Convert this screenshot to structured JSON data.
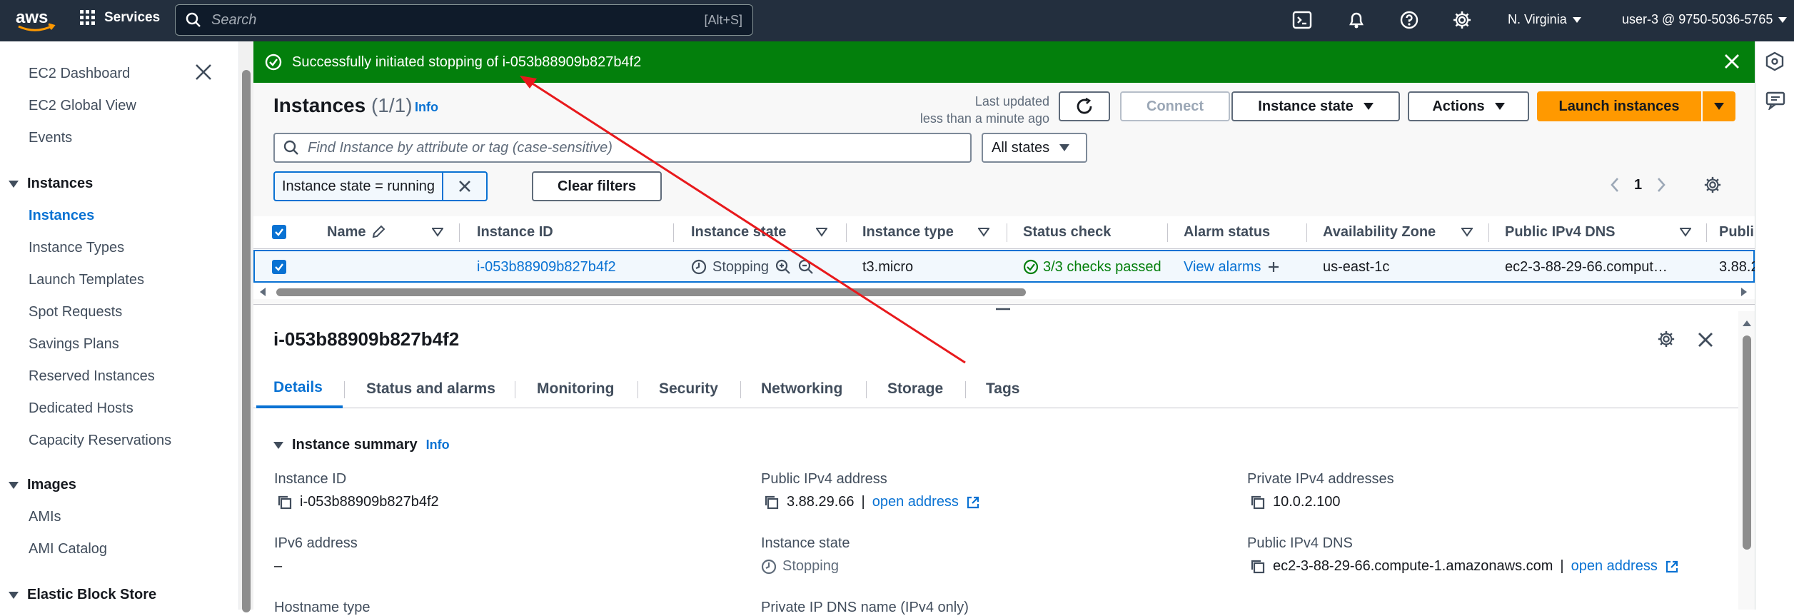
{
  "topbar": {
    "logo": "aws",
    "services_label": "Services",
    "search_placeholder": "Search",
    "search_shortcut": "[Alt+S]",
    "region": "N. Virginia",
    "account": "user-3 @ 9750-5036-5765"
  },
  "sidebar": {
    "items": [
      {
        "label": "EC2 Dashboard"
      },
      {
        "label": "EC2 Global View"
      },
      {
        "label": "Events"
      }
    ],
    "sections": [
      {
        "title": "Instances",
        "items": [
          "Instances",
          "Instance Types",
          "Launch Templates",
          "Spot Requests",
          "Savings Plans",
          "Reserved Instances",
          "Dedicated Hosts",
          "Capacity Reservations"
        ]
      },
      {
        "title": "Images",
        "items": [
          "AMIs",
          "AMI Catalog"
        ]
      },
      {
        "title": "Elastic Block Store",
        "items": []
      }
    ],
    "active_item": "Instances"
  },
  "flash": {
    "message": "Successfully initiated stopping of i-053b88909b827b4f2",
    "type": "success"
  },
  "instances_panel": {
    "title": "Instances",
    "count": "(1/1)",
    "info": "Info",
    "last_updated_line1": "Last updated",
    "last_updated_line2": "less than a minute ago",
    "connect_label": "Connect",
    "instance_state_label": "Instance state",
    "actions_label": "Actions",
    "launch_label": "Launch instances",
    "filter_placeholder": "Find Instance by attribute or tag (case-sensitive)",
    "states_filter": "All states",
    "token": "Instance state = running",
    "clear_filters": "Clear filters",
    "page": "1"
  },
  "table": {
    "columns": [
      "Name",
      "Instance ID",
      "Instance state",
      "Instance type",
      "Status check",
      "Alarm status",
      "Availability Zone",
      "Public IPv4 DNS",
      "Publi"
    ],
    "rows": [
      {
        "name": "",
        "instance_id": "i-053b88909b827b4f2",
        "state": "Stopping",
        "type": "t3.micro",
        "status_check": "3/3 checks passed",
        "alarm": "View alarms",
        "az": "us-east-1c",
        "public_dns": "ec2-3-88-29-66.comput…",
        "public_ip": "3.88.2"
      }
    ]
  },
  "details": {
    "instance_id": "i-053b88909b827b4f2",
    "tabs": [
      "Details",
      "Status and alarms",
      "Monitoring",
      "Security",
      "Networking",
      "Storage",
      "Tags"
    ],
    "active_tab": "Details",
    "summary_title": "Instance summary",
    "summary_info": "Info",
    "fields": {
      "instance_id_label": "Instance ID",
      "instance_id_value": "i-053b88909b827b4f2",
      "public_ipv4_label": "Public IPv4 address",
      "public_ipv4_value": "3.88.29.66",
      "open_address": "open address",
      "private_ipv4_label": "Private IPv4 addresses",
      "private_ipv4_value": "10.0.2.100",
      "ipv6_label": "IPv6 address",
      "ipv6_value": "–",
      "instance_state_label": "Instance state",
      "instance_state_value": "Stopping",
      "public_dns_label": "Public IPv4 DNS",
      "public_dns_value": "ec2-3-88-29-66.compute-1.amazonaws.com",
      "hostname_type_label": "Hostname type",
      "private_dns_label": "Private IP DNS name (IPv4 only)"
    }
  },
  "colors": {
    "topbar": "#232f3e",
    "success": "#037f0c",
    "link": "#0972d3",
    "primary": "#ff9900",
    "annotation_arrow": "#e8191c"
  }
}
